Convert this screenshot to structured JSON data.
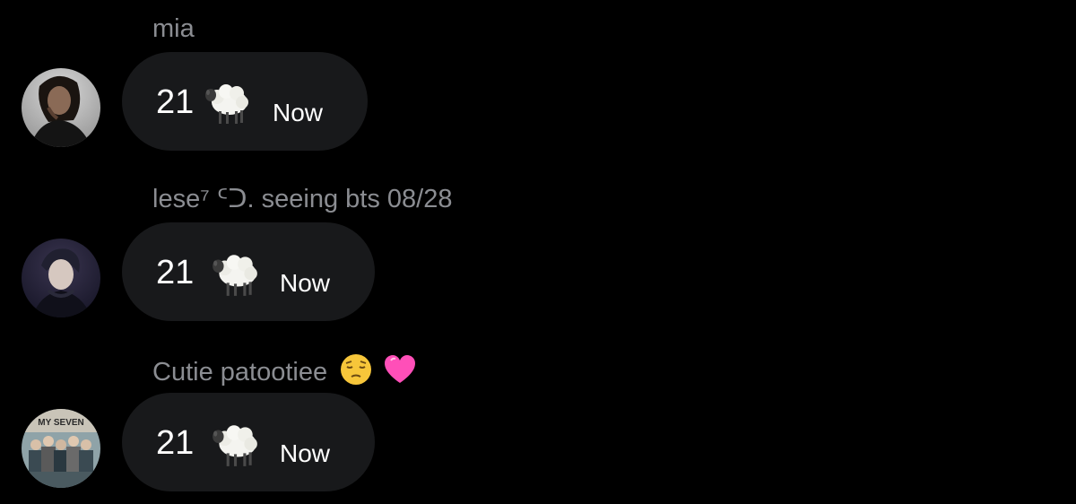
{
  "conversation": {
    "messages": [
      {
        "sender": "mia",
        "text": "21",
        "emoji_icon": "sheep-icon",
        "timestamp": "Now",
        "avatar_icon": "avatar-photo-woman"
      },
      {
        "sender": "lese⁷ ᑦᑐ. seeing bts 08/28",
        "text": "21",
        "emoji_icon": "sheep-icon",
        "timestamp": "Now",
        "avatar_icon": "avatar-photo-man"
      },
      {
        "sender": "Cutie patootiee",
        "sender_emojis": [
          "pensive-face-icon",
          "pink-heart-icon"
        ],
        "text": "21",
        "emoji_icon": "sheep-icon",
        "timestamp": "Now",
        "avatar_icon": "avatar-photo-group",
        "avatar_caption": "MY SEVEN"
      }
    ]
  },
  "colors": {
    "background": "#000000",
    "bubble": "#18191b",
    "sender_name": "#8b8d92",
    "message_text": "#ffffff",
    "heart": "#ff4fb8"
  }
}
